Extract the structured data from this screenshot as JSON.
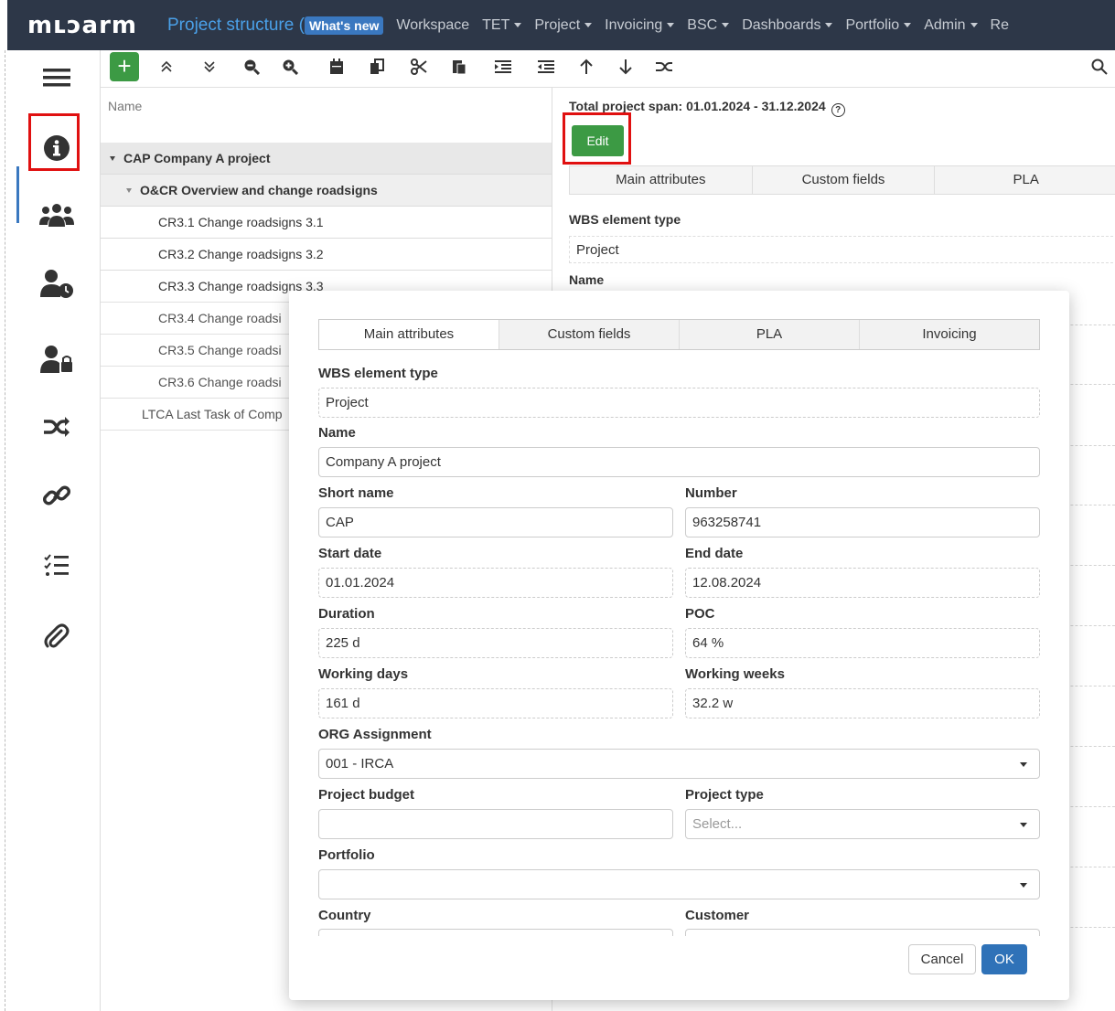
{
  "topnav": {
    "logo": "mʟɔarm",
    "title": "Project structure (",
    "whats_new": "What's new",
    "items": [
      {
        "label": "Workspace",
        "caret": false
      },
      {
        "label": "TET",
        "caret": true
      },
      {
        "label": "Project",
        "caret": true
      },
      {
        "label": "Invoicing",
        "caret": true
      },
      {
        "label": "BSC",
        "caret": true
      },
      {
        "label": "Dashboards",
        "caret": true
      },
      {
        "label": "Portfolio",
        "caret": true
      },
      {
        "label": "Admin",
        "caret": true
      },
      {
        "label": "Re",
        "caret": false
      }
    ]
  },
  "sidebar": {
    "icons": [
      "hamburger-icon",
      "info-icon",
      "team-icon",
      "user-clock-icon",
      "user-lock-icon",
      "shuffle-icon",
      "link-icon",
      "checklist-icon",
      "paperclip-icon"
    ]
  },
  "toolbar": {
    "add_label": "+",
    "icons": [
      "expand-up-icon",
      "expand-down-icon",
      "zoom-out-icon",
      "zoom-in-icon",
      "calendar-icon",
      "copy-icon",
      "cut-icon",
      "paste-icon",
      "indent-icon",
      "outdent-icon",
      "arrow-up-icon",
      "arrow-down-icon",
      "shuffle-icon"
    ],
    "search_icon": "search-icon"
  },
  "tree": {
    "header": "Name",
    "rows": [
      {
        "label": "CAP Company A project",
        "level": 0,
        "expanded": true
      },
      {
        "label": "O&CR Overview and change roadsigns",
        "level": 1,
        "expanded": true
      },
      {
        "label": "CR3.1 Change roadsigns 3.1",
        "level": 2
      },
      {
        "label": "CR3.2 Change roadsigns 3.2",
        "level": 2
      },
      {
        "label": "CR3.3 Change roadsigns 3.3",
        "level": 2
      },
      {
        "label": "CR3.4 Change roadsi",
        "level": 2
      },
      {
        "label": "CR3.5 Change roadsi",
        "level": 2
      },
      {
        "label": "CR3.6 Change roadsi",
        "level": 2
      },
      {
        "label": "LTCA Last Task of Comp",
        "level": 1
      }
    ]
  },
  "right_panel": {
    "span_text": "Total project span: 01.01.2024 - 31.12.2024",
    "edit_label": "Edit",
    "tabs": [
      "Main attributes",
      "Custom fields",
      "PLA"
    ],
    "wbs_label": "WBS element type",
    "wbs_value": "Project",
    "name_label": "Name"
  },
  "modal": {
    "tabs": [
      "Main attributes",
      "Custom fields",
      "PLA",
      "Invoicing"
    ],
    "active_tab": 0,
    "fields": {
      "wbs_type": {
        "label": "WBS element type",
        "value": "Project"
      },
      "name": {
        "label": "Name",
        "value": "Company A project"
      },
      "short_name": {
        "label": "Short name",
        "value": "CAP"
      },
      "number": {
        "label": "Number",
        "value": "963258741"
      },
      "start_date": {
        "label": "Start date",
        "value": "01.01.2024"
      },
      "end_date": {
        "label": "End date",
        "value": "12.08.2024"
      },
      "duration": {
        "label": "Duration",
        "value": "225 d"
      },
      "poc": {
        "label": "POC",
        "value": "64 %"
      },
      "working_days": {
        "label": "Working days",
        "value": "161 d"
      },
      "working_weeks": {
        "label": "Working weeks",
        "value": "32.2 w"
      },
      "org_assignment": {
        "label": "ORG Assignment",
        "value": "001 - IRCA"
      },
      "project_budget": {
        "label": "Project budget",
        "value": ""
      },
      "project_type": {
        "label": "Project type",
        "placeholder": "Select..."
      },
      "portfolio": {
        "label": "Portfolio",
        "value": ""
      },
      "country": {
        "label": "Country",
        "value": ""
      },
      "customer": {
        "label": "Customer",
        "value": ""
      }
    },
    "cancel_label": "Cancel",
    "ok_label": "OK"
  },
  "colors": {
    "nav_bg": "#2d3748",
    "accent_blue": "#2f72b8",
    "green": "#3c9a44",
    "highlight_red": "#e01010"
  }
}
